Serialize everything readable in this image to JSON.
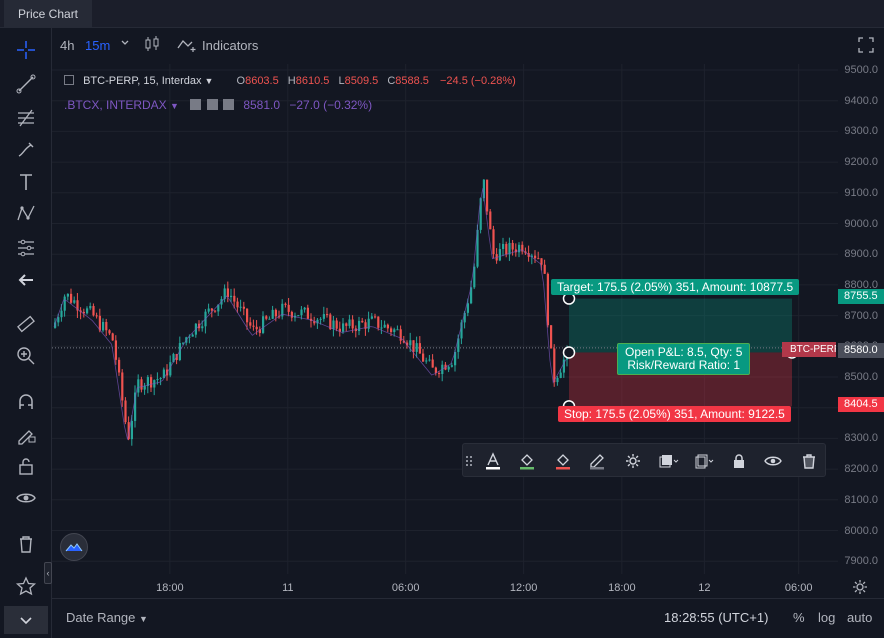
{
  "tab": {
    "label": "Price Chart"
  },
  "toolbar": {
    "interval_4h": "4h",
    "interval_15m": "15m",
    "indicators": "Indicators"
  },
  "legend": {
    "main_symbol": "BTC-PERP, 15, Interdax",
    "o_label": "O",
    "o_value": "8603.5",
    "h_label": "H",
    "h_value": "8610.5",
    "l_label": "L",
    "l_value": "8509.5",
    "c_label": "C",
    "c_value": "8588.5",
    "change": "−24.5 (−0.28%)",
    "compare_symbol": ".BTCX, INTERDAX",
    "compare_value": "8581.0",
    "compare_change": "−27.0 (−0.32%)"
  },
  "yaxis": {
    "ticks": [
      "9500.0",
      "9400.0",
      "9300.0",
      "9200.0",
      "9100.0",
      "9000.0",
      "8900.0",
      "8800.0",
      "8700.0",
      "8600.0",
      "8500.0",
      "8400.0",
      "8300.0",
      "8200.0",
      "8100.0",
      "8000.0",
      "7900.0"
    ],
    "target_price": "8755.5",
    "current_price": "8580.0",
    "stop_price": "8404.5",
    "symbol_tag": "BTC-PERP"
  },
  "xaxis": {
    "ticks": [
      {
        "label": "18:00",
        "t": 0.15
      },
      {
        "label": "11",
        "t": 0.3
      },
      {
        "label": "06:00",
        "t": 0.45
      },
      {
        "label": "12:00",
        "t": 0.6
      },
      {
        "label": "18:00",
        "t": 0.725
      },
      {
        "label": "12",
        "t": 0.83
      },
      {
        "label": "06:00",
        "t": 0.95
      }
    ]
  },
  "position": {
    "target_text": "Target: 175.5 (2.05%) 351, Amount: 10877.5",
    "stop_text": "Stop: 175.5 (2.05%) 351, Amount: 9122.5",
    "pnl_text": "Open P&L: 8.5, Qty: 5",
    "rr_text": "Risk/Reward Ratio: 1"
  },
  "bottombar": {
    "date_range": "Date Range",
    "clock": "18:28:55 (UTC+1)",
    "percent": "%",
    "log": "log",
    "auto": "auto"
  },
  "colors": {
    "bg": "#131722",
    "up": "#26a69a",
    "down": "#ef5350",
    "accent": "#2962ff",
    "target": "#089981",
    "stop": "#f23645"
  }
}
